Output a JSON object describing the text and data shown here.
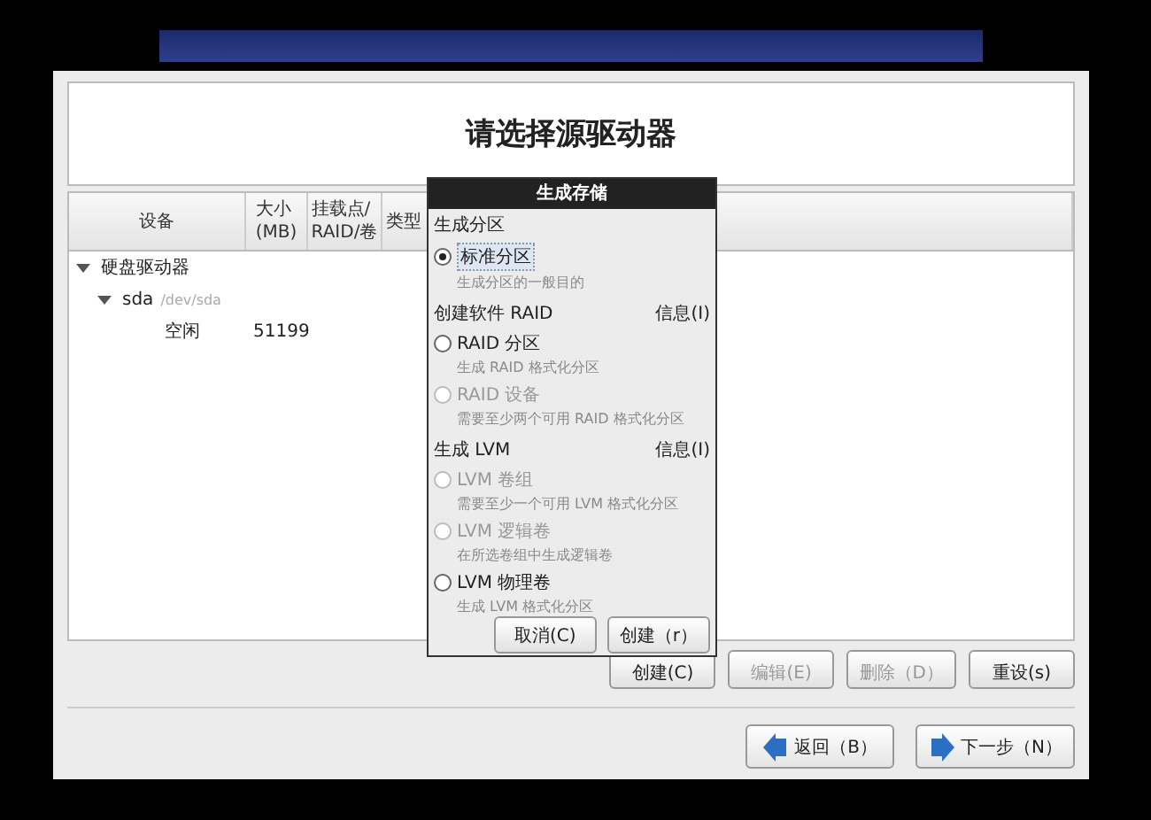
{
  "title": "请选择源驱动器",
  "table": {
    "columns": [
      "设备",
      "大小\n(MB)",
      "挂载点/\nRAID/卷",
      "类型"
    ],
    "rows": [
      {
        "device": "硬盘驱动器",
        "expanded": true,
        "children": [
          {
            "device": "sda",
            "detail": "/dev/sda",
            "expanded": true,
            "children": [
              {
                "device": "空闲",
                "size": "51199"
              }
            ]
          }
        ]
      }
    ]
  },
  "actions": [
    {
      "label": "创建(C)",
      "disabled": false
    },
    {
      "label": "编辑(E)",
      "disabled": true
    },
    {
      "label": "删除（D）",
      "disabled": true
    },
    {
      "label": "重设(s)",
      "disabled": false
    }
  ],
  "nav": [
    {
      "label": "返回（B）",
      "kind": "back"
    },
    {
      "label": "下一步（N）",
      "kind": "next"
    }
  ],
  "dialog": {
    "title": "生成存储",
    "sections": [
      {
        "heading": "生成分区",
        "options": [
          {
            "label": "标准分区",
            "hint": "生成分区的一般目的",
            "selected": true,
            "disabled": false
          }
        ]
      },
      {
        "heading": "创建软件 RAID",
        "info": "信息(I)",
        "options": [
          {
            "label": "RAID 分区",
            "hint": "生成 RAID 格式化分区",
            "selected": false,
            "disabled": false
          },
          {
            "label": "RAID 设备",
            "hint": "需要至少两个可用 RAID 格式化分区",
            "selected": false,
            "disabled": true
          }
        ]
      },
      {
        "heading": "生成 LVM",
        "info": "信息(I)",
        "options": [
          {
            "label": "LVM 卷组",
            "hint": "需要至少一个可用 LVM 格式化分区",
            "selected": false,
            "disabled": true
          },
          {
            "label": "LVM 逻辑卷",
            "hint": "在所选卷组中生成逻辑卷",
            "selected": false,
            "disabled": true
          },
          {
            "label": "LVM 物理卷",
            "hint": "生成 LVM 格式化分区",
            "selected": false,
            "disabled": false
          }
        ]
      }
    ],
    "buttons": [
      "取消(C)",
      "创建（r）"
    ]
  }
}
